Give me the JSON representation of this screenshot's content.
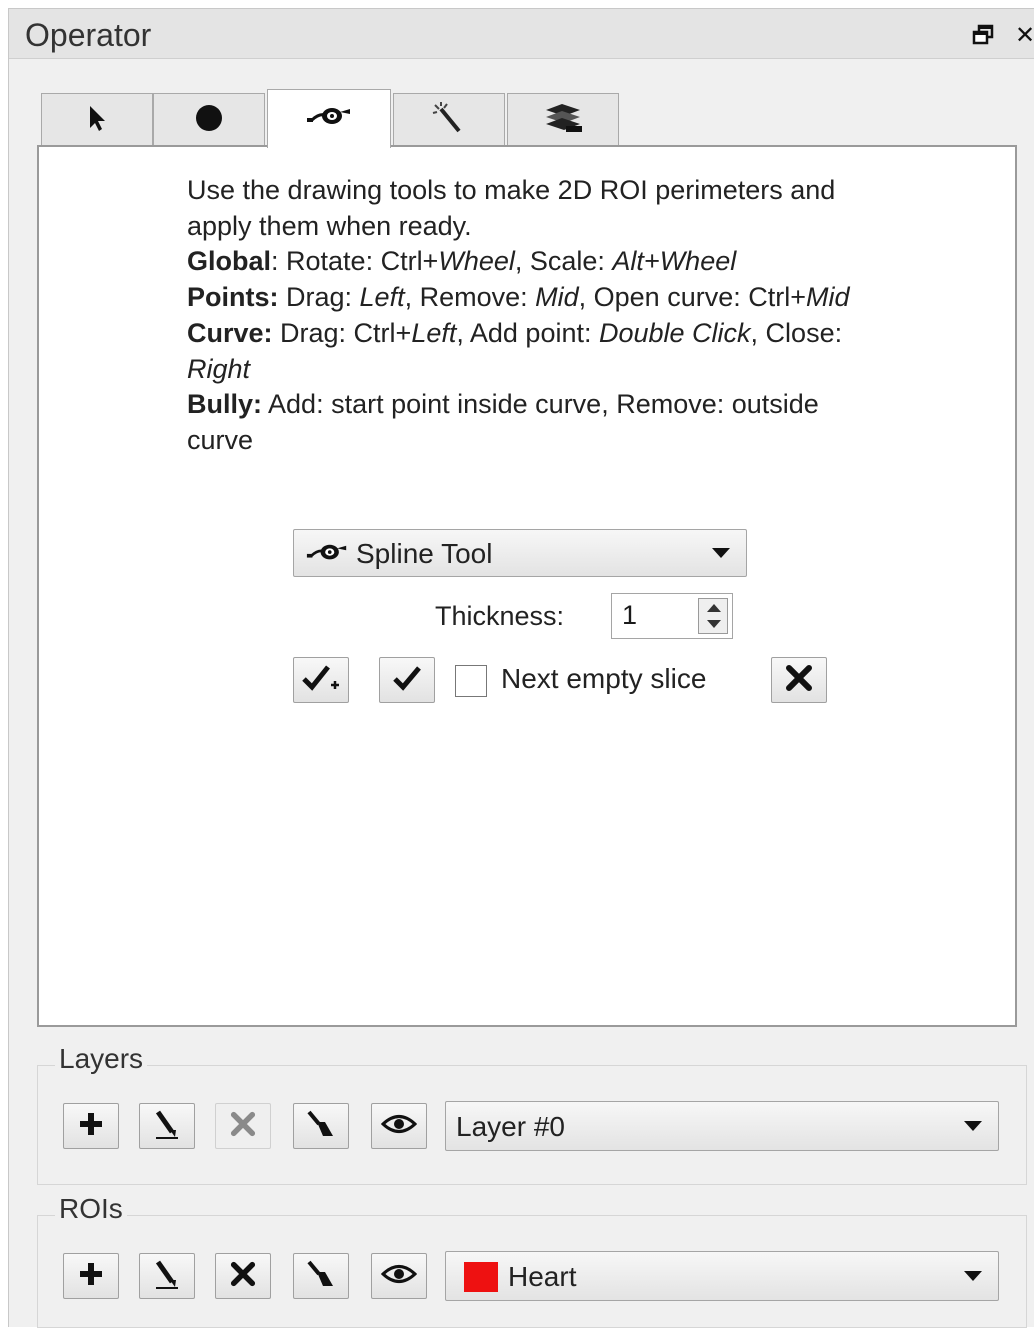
{
  "window": {
    "title": "Operator",
    "restore_icon": "restore-window-icon",
    "close_label": "✕"
  },
  "tabs": [
    {
      "icon": "pointer-arrow-icon",
      "active": false
    },
    {
      "icon": "filled-circle-icon",
      "active": false
    },
    {
      "icon": "spline-pen-icon",
      "active": true
    },
    {
      "icon": "magic-wand-icon",
      "active": false
    },
    {
      "icon": "layers-stack-icon",
      "active": false
    }
  ],
  "help": {
    "intro": "Use the drawing tools to make 2D ROI perimeters and apply them when ready.",
    "global_label": "Global",
    "global_text_1": ": Rotate: Ctrl+",
    "global_key_1": "Wheel",
    "global_text_2": ", Scale: ",
    "global_key_2": "Alt+Wheel",
    "points_label": "Points:",
    "points_text_1": " Drag: ",
    "points_key_1": "Left",
    "points_text_2": ", Remove: ",
    "points_key_2": "Mid",
    "points_text_3": ", Open curve: Ctrl+",
    "points_key_3": "Mid",
    "curve_label": "Curve:",
    "curve_text_1": " Drag: Ctrl+",
    "curve_key_1": "Left",
    "curve_text_2": ", Add point: ",
    "curve_key_2": "Double Click",
    "curve_text_3": ", Close: ",
    "curve_key_3": "Right",
    "bully_label": "Bully:",
    "bully_text": " Add: start point inside curve, Remove: outside curve"
  },
  "tool_select": {
    "value": "Spline Tool",
    "icon": "spline-pen-icon"
  },
  "thickness": {
    "label": "Thickness:",
    "value": "1"
  },
  "actions": {
    "apply_add_icon": "check-plus-icon",
    "apply_icon": "check-icon",
    "next_empty_slice_label": "Next empty slice",
    "next_empty_slice_checked": false,
    "discard_icon": "x-icon"
  },
  "layers": {
    "label": "Layers",
    "selected": "Layer #0",
    "buttons": [
      "plus-icon",
      "pen-icon",
      "x-icon",
      "brush-icon",
      "eye-icon"
    ]
  },
  "rois": {
    "label": "ROIs",
    "selected": "Heart",
    "swatch_color": "#ee1111",
    "buttons": [
      "plus-icon",
      "pen-icon",
      "x-icon",
      "brush-icon",
      "eye-icon"
    ]
  }
}
